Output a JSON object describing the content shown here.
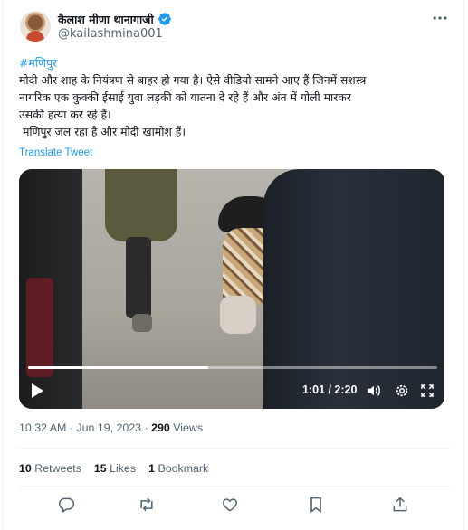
{
  "author": {
    "display_name": "कैलाश मीणा थानागाजी",
    "handle": "@kailashmina001",
    "verified": true
  },
  "tweet": {
    "hashtag": "#मणिपुर",
    "lines": [
      "मोदी और शाह के नियंत्रण से बाहर हो गया है।  ऐसे वीडियो सामने आए हैं जिनमें सशस्त्र",
      "नागरिक एक कुक्की ईसाई युवा लड़की को यातना दे रहे हैं और अंत में गोली मारकर",
      "उसकी हत्या कर रहे हैं।",
      " मणिपुर जल रहा है और मोदी खामोश हैं।"
    ],
    "translate_label": "Translate Tweet"
  },
  "video": {
    "time_display": "1:01 / 2:20",
    "progress_fraction": 0.44
  },
  "meta": {
    "time": "10:32 AM",
    "separator": "·",
    "date": "Jun 19, 2023",
    "views_count": "290",
    "views_label": "Views"
  },
  "stats": {
    "retweets_count": "10",
    "retweets_label": "Retweets",
    "likes_count": "15",
    "likes_label": "Likes",
    "bookmarks_count": "1",
    "bookmarks_label": "Bookmark"
  },
  "colors": {
    "accent": "#1d9bf0",
    "secondary_text": "#536471",
    "primary_text": "#0f1419"
  },
  "icons": [
    "verified-badge-icon",
    "more-icon",
    "play-icon",
    "volume-icon",
    "settings-icon",
    "fullscreen-icon",
    "reply-icon",
    "retweet-icon",
    "like-icon",
    "bookmark-icon",
    "share-icon"
  ]
}
